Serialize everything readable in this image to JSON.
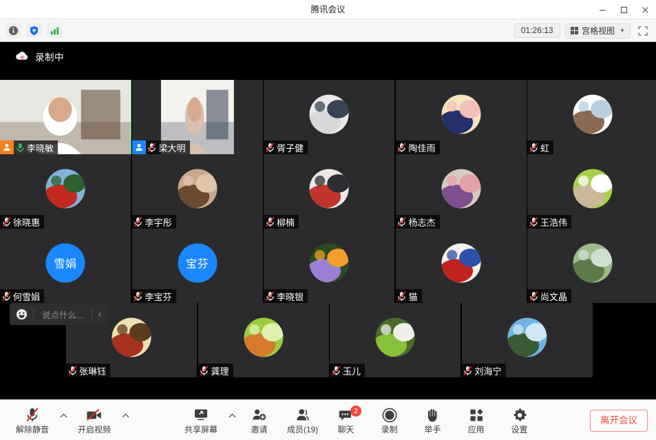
{
  "window": {
    "title": "腾讯会议",
    "minimize_icon": "minimize-icon",
    "maximize_icon": "maximize-icon",
    "close_icon": "close-icon"
  },
  "toolbar": {
    "info_icon": "info-icon",
    "security_icon": "shield-icon",
    "network_icon": "signal-bars-icon",
    "timer": "01:26:13",
    "view_mode": "宫格视图",
    "view_caret": "▼",
    "fullscreen_icon": "fullscreen-icon"
  },
  "stage": {
    "recording_label": "录制中",
    "recording_icon": "cloud-record-icon"
  },
  "chat_bar": {
    "emoji_icon": "smiley-icon",
    "placeholder": "说点什么...",
    "collapse_icon": "chevron-left-icon"
  },
  "participants": {
    "rows": [
      {
        "offset": 0,
        "tiles": [
          {
            "name": "李晓敏",
            "role": "host",
            "role_badge": "host-badge",
            "mic": "on",
            "media": "video",
            "media_kind": "camera-room",
            "active_speaker": true
          },
          {
            "name": "梁大明",
            "role": "cohost",
            "role_badge": "cohost-badge",
            "mic": "muted",
            "media": "video",
            "media_kind": "camera-portrait",
            "active_speaker": false
          },
          {
            "name": "胥子健",
            "role": "member",
            "mic": "muted",
            "media": "avatar",
            "media_kind": "photo-person-white",
            "active_speaker": false
          },
          {
            "name": "陶佳雨",
            "role": "member",
            "mic": "muted",
            "media": "avatar",
            "media_kind": "cartoon-boy",
            "active_speaker": false
          },
          {
            "name": "虹",
            "role": "member",
            "mic": "muted",
            "media": "avatar",
            "media_kind": "cartoon-woman",
            "active_speaker": false
          }
        ]
      },
      {
        "offset": 0,
        "tiles": [
          {
            "name": "徐晓惠",
            "role": "member",
            "mic": "muted",
            "media": "avatar",
            "media_kind": "photo-red-flowers",
            "active_speaker": false
          },
          {
            "name": "李宇彤",
            "role": "member",
            "mic": "muted",
            "media": "avatar",
            "media_kind": "photo-squirrel",
            "active_speaker": false
          },
          {
            "name": "柳楠",
            "role": "member",
            "mic": "muted",
            "media": "avatar",
            "media_kind": "photo-child-red",
            "active_speaker": false
          },
          {
            "name": "杨志杰",
            "role": "member",
            "mic": "muted",
            "media": "avatar",
            "media_kind": "photo-collage",
            "active_speaker": false
          },
          {
            "name": "王浩伟",
            "role": "member",
            "mic": "muted",
            "media": "avatar",
            "media_kind": "photo-puppy-toy",
            "active_speaker": false
          }
        ]
      },
      {
        "offset": 0,
        "tiles": [
          {
            "name": "何雪娟",
            "role": "member",
            "mic": "muted",
            "media": "initials",
            "initials": "雪娟",
            "active_speaker": false
          },
          {
            "name": "李宝芬",
            "role": "member",
            "mic": "muted",
            "media": "initials",
            "initials": "宝芬",
            "active_speaker": false
          },
          {
            "name": "李晓银",
            "role": "member",
            "mic": "muted",
            "media": "avatar",
            "media_kind": "photo-purple-crocus",
            "active_speaker": false
          },
          {
            "name": "猫",
            "role": "member",
            "mic": "muted",
            "media": "avatar",
            "media_kind": "photo-illustration-red",
            "active_speaker": false
          },
          {
            "name": "尚文晶",
            "role": "member",
            "mic": "muted",
            "media": "avatar",
            "media_kind": "photo-lake-swan",
            "active_speaker": false
          }
        ]
      },
      {
        "offset": 96,
        "tiles": [
          {
            "name": "张琳钰",
            "role": "member",
            "mic": "muted",
            "media": "avatar",
            "media_kind": "photo-tram-sepia",
            "active_speaker": false
          },
          {
            "name": "龚理",
            "role": "member",
            "mic": "muted",
            "media": "avatar",
            "media_kind": "photo-green-bird",
            "active_speaker": false
          },
          {
            "name": "玉儿",
            "role": "member",
            "mic": "muted",
            "media": "avatar",
            "media_kind": "photo-dogs-grass",
            "active_speaker": false
          },
          {
            "name": "刘海宁",
            "role": "member",
            "mic": "muted",
            "media": "avatar",
            "media_kind": "photo-lake-reflection",
            "active_speaker": false
          }
        ]
      }
    ]
  },
  "bottom_bar": {
    "mute": {
      "label": "解除静音",
      "icon": "mic-muted-icon",
      "has_caret": true
    },
    "video": {
      "label": "开启视频",
      "icon": "camera-off-icon",
      "has_caret": true
    },
    "share": {
      "label": "共享屏幕",
      "icon": "share-screen-icon",
      "has_caret": true
    },
    "invite": {
      "label": "邀请",
      "icon": "invite-person-icon"
    },
    "members": {
      "label": "成员(19)",
      "icon": "members-icon"
    },
    "chat": {
      "label": "聊天",
      "icon": "chat-bubble-icon",
      "badge": "2"
    },
    "record": {
      "label": "录制",
      "icon": "record-circle-icon"
    },
    "raise_hand": {
      "label": "举手",
      "icon": "raise-hand-icon"
    },
    "apps": {
      "label": "应用",
      "icon": "apps-grid-icon"
    },
    "settings": {
      "label": "设置",
      "icon": "gear-icon"
    },
    "leave": {
      "label": "离开会议"
    }
  },
  "colors": {
    "host_badge": "#f58220",
    "cohost_badge": "#1a87ff",
    "active_border": "#22c55e",
    "mic_on": "#22c55e",
    "mic_muted": "#d93025",
    "leave_red": "#ef4b42",
    "badge_red": "#f5483b",
    "tile_bg": "#2b2b2d"
  }
}
